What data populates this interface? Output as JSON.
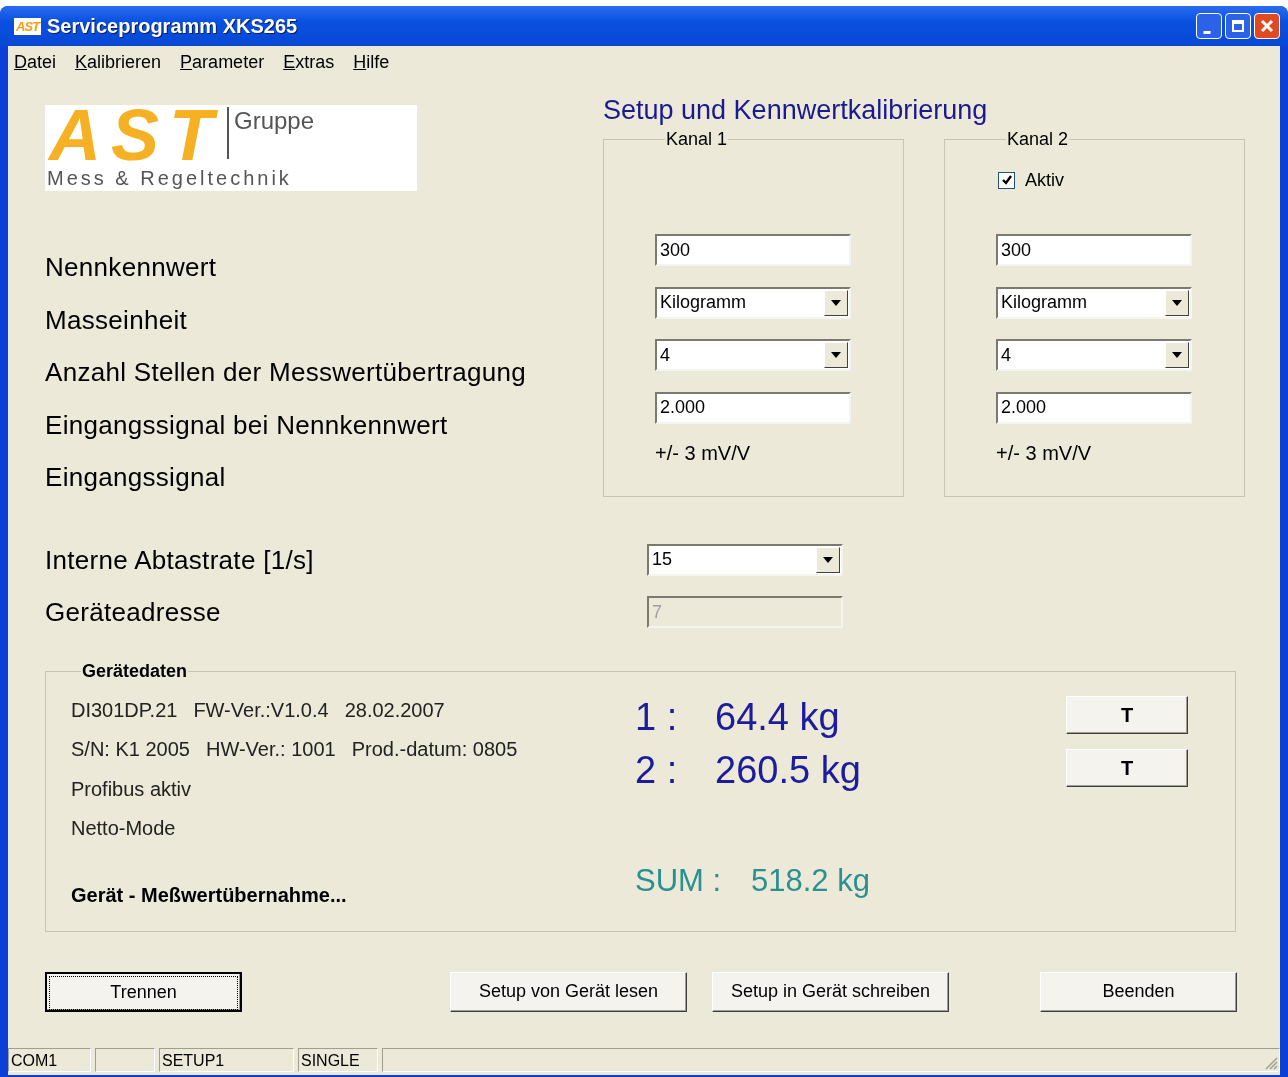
{
  "window": {
    "icon_text": "AST",
    "title": "Serviceprogramm XKS265"
  },
  "menu": [
    "Datei",
    "Kalibrieren",
    "Parameter",
    "Extras",
    "Hilfe"
  ],
  "logo": {
    "mark": "AST",
    "group": "Gruppe",
    "tagline": "Mess & Regeltechnik"
  },
  "heading": "Setup und Kennwertkalibrierung",
  "parameter_labels": [
    "Nennkennwert",
    "Masseinheit",
    "Anzahl Stellen der Messwertübertragung",
    "Eingangssignal bei Nennkennwert",
    "Eingangssignal"
  ],
  "channels": [
    {
      "title": "Kanal 1",
      "fields": [
        {
          "kind": "text",
          "value": "300"
        },
        {
          "kind": "combo",
          "value": "Kilogramm"
        },
        {
          "kind": "combo",
          "value": "4"
        },
        {
          "kind": "text",
          "value": "2.000"
        },
        {
          "kind": "readout",
          "value": "+/- 3 mV/V"
        }
      ]
    },
    {
      "title": "Kanal 2",
      "checkbox": {
        "label": "Aktiv",
        "checked": true
      },
      "fields": [
        {
          "kind": "text",
          "value": "300"
        },
        {
          "kind": "combo",
          "value": "Kilogramm"
        },
        {
          "kind": "combo",
          "value": "4"
        },
        {
          "kind": "text",
          "value": "2.000"
        },
        {
          "kind": "readout",
          "value": "+/- 3 mV/V"
        }
      ]
    }
  ],
  "settings": [
    {
      "label": "Interne Abtastrate [1/s]",
      "kind": "combo",
      "value": "15",
      "disabled": false
    },
    {
      "label": "Geräteadresse",
      "kind": "text",
      "value": "7",
      "disabled": true
    }
  ],
  "device_data": {
    "title": "Gerätedaten",
    "info_lines": [
      [
        "DI301DP.21",
        "FW-Ver.:V1.0.4",
        "28.02.2007"
      ],
      [
        "S/N: K1 2005",
        "HW-Ver.: 1001",
        "Prod.-datum: 0805"
      ],
      [
        "Profibus aktiv"
      ],
      [
        "Netto-Mode"
      ]
    ],
    "status": "Gerät - Meßwertübernahme...",
    "readings": [
      {
        "channel": "1 :",
        "value": "64.4 kg",
        "button": "T"
      },
      {
        "channel": "2 :",
        "value": "260.5 kg",
        "button": "T"
      }
    ],
    "sum": {
      "label": "SUM :",
      "value": "518.2 kg"
    }
  },
  "buttons": [
    {
      "label": "Trennen",
      "focused": true
    },
    {
      "label": "Setup von Gerät lesen",
      "focused": false
    },
    {
      "label": "Setup in Gerät schreiben",
      "focused": false
    },
    {
      "label": "Beenden",
      "focused": false
    }
  ],
  "status_bar": [
    {
      "kind": "text",
      "text": "COM1"
    },
    {
      "kind": "blank"
    },
    {
      "kind": "text",
      "text": "SETUP1"
    },
    {
      "kind": "text",
      "text": "SINGLE"
    },
    {
      "kind": "blank"
    }
  ]
}
